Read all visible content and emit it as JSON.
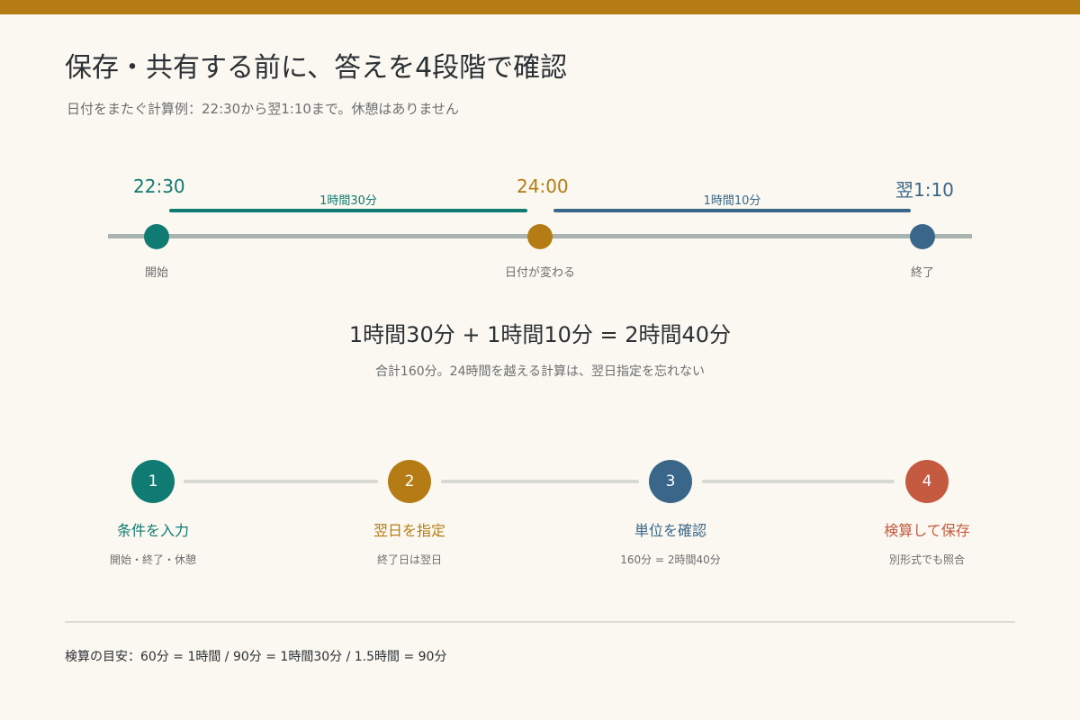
{
  "colors": {
    "accent_top": "#b57c16",
    "teal": "#0f7b72",
    "gold": "#b57c16",
    "blue": "#3a6689",
    "red": "#c45a40",
    "axis": "#a9b4b0",
    "background": "#faf8f0"
  },
  "header": {
    "title": "保存・共有する前に、答えを4段階で確認",
    "subtitle": "日付をまたぐ計算例：22:30から翌1:10まで。休憩はありません"
  },
  "timeline": {
    "start_time": "22:30",
    "mid_time": "24:00",
    "end_time": "翌1:10",
    "segment1_label": "1時間30分",
    "segment2_label": "1時間10分",
    "start_label": "開始",
    "mid_label": "日付が変わる",
    "end_label": "終了"
  },
  "calculation": {
    "equation": "1時間30分 + 1時間10分 = 2時間40分",
    "note": "合計160分。24時間を越える計算は、翌日指定を忘れない"
  },
  "steps": [
    {
      "number": "1",
      "title": "条件を入力",
      "desc": "開始・終了・休憩",
      "color": "#0f7b72"
    },
    {
      "number": "2",
      "title": "翌日を指定",
      "desc": "終了日は翌日",
      "color": "#b57c16"
    },
    {
      "number": "3",
      "title": "単位を確認",
      "desc": "160分 = 2時間40分",
      "color": "#3a6689"
    },
    {
      "number": "4",
      "title": "検算して保存",
      "desc": "別形式でも照合",
      "color": "#c45a40"
    }
  ],
  "footer": {
    "text": "検算の目安：60分 = 1時間 / 90分 = 1時間30分 / 1.5時間 = 90分"
  }
}
